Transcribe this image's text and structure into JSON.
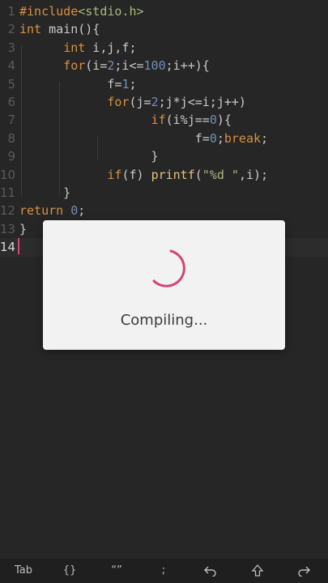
{
  "editor": {
    "line_numbers": [
      "1",
      "2",
      "3",
      "4",
      "5",
      "6",
      "7",
      "8",
      "9",
      "10",
      "11",
      "12",
      "13",
      "14"
    ],
    "current_line": "14",
    "lines": [
      [
        [
          "kw",
          "#include"
        ],
        [
          "str",
          "<stdio.h>"
        ]
      ],
      [
        [
          "kw",
          "int"
        ],
        [
          "sym",
          " main(){"
        ]
      ],
      [
        [
          "sym",
          "      "
        ],
        [
          "kw",
          "int"
        ],
        [
          "sym",
          " i,j,f;"
        ]
      ],
      [
        [
          "sym",
          "      "
        ],
        [
          "kw",
          "for"
        ],
        [
          "sym",
          "(i="
        ],
        [
          "num",
          "2"
        ],
        [
          "sym",
          ";i<="
        ],
        [
          "num",
          "100"
        ],
        [
          "sym",
          ";i++){"
        ]
      ],
      [
        [
          "sym",
          "            f="
        ],
        [
          "num",
          "1"
        ],
        [
          "sym",
          ";"
        ]
      ],
      [
        [
          "sym",
          "            "
        ],
        [
          "kw",
          "for"
        ],
        [
          "sym",
          "(j="
        ],
        [
          "num",
          "2"
        ],
        [
          "sym",
          ";j*j<=i;j++)"
        ]
      ],
      [
        [
          "sym",
          "                  "
        ],
        [
          "kw",
          "if"
        ],
        [
          "sym",
          "(i%j=="
        ],
        [
          "num",
          "0"
        ],
        [
          "sym",
          "){"
        ]
      ],
      [
        [
          "sym",
          "                        f="
        ],
        [
          "num",
          "0"
        ],
        [
          "sym",
          ";"
        ],
        [
          "kw",
          "break"
        ],
        [
          "sym",
          ";"
        ]
      ],
      [
        [
          "sym",
          "                  }"
        ]
      ],
      [
        [
          "sym",
          "            "
        ],
        [
          "kw",
          "if"
        ],
        [
          "sym",
          "(f) "
        ],
        [
          "fn",
          "printf"
        ],
        [
          "sym",
          "("
        ],
        [
          "str",
          "\"%d \""
        ],
        [
          "sym",
          ",i);"
        ]
      ],
      [
        [
          "sym",
          "      }"
        ]
      ],
      [
        [
          "kw",
          "return"
        ],
        [
          "sym",
          " "
        ],
        [
          "num",
          "0"
        ],
        [
          "sym",
          ";"
        ]
      ],
      [
        [
          "sym",
          "}"
        ]
      ],
      []
    ]
  },
  "dialog": {
    "message": "Compiling..."
  },
  "toolbar": {
    "tab_label": "Tab",
    "braces_label": "{}",
    "quotes_label": "“”",
    "semicolon_label": ";",
    "icons": [
      "undo-icon",
      "shift-up-icon",
      "redo-icon"
    ]
  },
  "colors": {
    "accent": "#d34770",
    "keyword": "#d9903f",
    "number": "#6f8fb8",
    "string": "#a8b87a",
    "background": "#262626"
  }
}
